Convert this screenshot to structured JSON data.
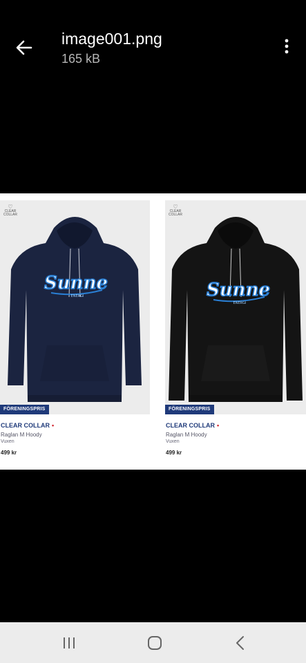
{
  "header": {
    "file_name": "image001.png",
    "file_size": "165 kB"
  },
  "image": {
    "products": [
      {
        "logo_text": "CLEAR COLLAR",
        "badge": "FÖRENINGSPRIS",
        "brand": "CLEAR COLLAR",
        "name": "Raglan M Hoody",
        "subtitle": "Vuxen",
        "price": "499 kr",
        "print_text": "Sunne",
        "print_subtext": "ENERGI",
        "hoodie_color": "#1b2440"
      },
      {
        "logo_text": "CLEAR COLLAR",
        "badge": "FÖRENINGSPRIS",
        "brand": "CLEAR COLLAR",
        "name": "Raglan M Hoody",
        "subtitle": "Vuxen",
        "price": "499 kr",
        "print_text": "Sunne",
        "print_subtext": "ENERGI",
        "hoodie_color": "#141414"
      }
    ]
  },
  "icons": {
    "back": "arrow-left-icon",
    "menu": "more-vertical-icon",
    "recents": "recent-apps-icon",
    "home": "home-icon",
    "nav_back": "chevron-left-icon"
  },
  "colors": {
    "accent_blue": "#1f3a7a",
    "accent_red": "#d0202a"
  }
}
